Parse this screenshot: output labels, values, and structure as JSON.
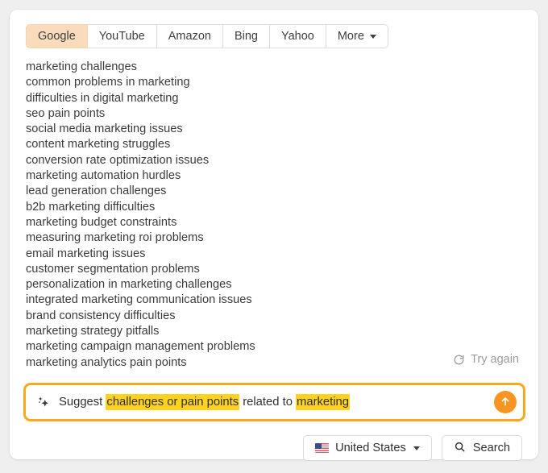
{
  "tabs": [
    {
      "label": "Google",
      "active": true,
      "caret": false,
      "name": "tab-google"
    },
    {
      "label": "YouTube",
      "active": false,
      "caret": false,
      "name": "tab-youtube"
    },
    {
      "label": "Amazon",
      "active": false,
      "caret": false,
      "name": "tab-amazon"
    },
    {
      "label": "Bing",
      "active": false,
      "caret": false,
      "name": "tab-bing"
    },
    {
      "label": "Yahoo",
      "active": false,
      "caret": false,
      "name": "tab-yahoo"
    },
    {
      "label": "More",
      "active": false,
      "caret": true,
      "name": "tab-more"
    }
  ],
  "suggestions": [
    "marketing challenges",
    "common problems in marketing",
    "difficulties in digital marketing",
    "seo pain points",
    "social media marketing issues",
    "content marketing struggles",
    "conversion rate optimization issues",
    "marketing automation hurdles",
    "lead generation challenges",
    "b2b marketing difficulties",
    "marketing budget constraints",
    "measuring marketing roi problems",
    "email marketing issues",
    "customer segmentation problems",
    "personalization in marketing challenges",
    "integrated marketing communication issues",
    "brand consistency difficulties",
    "marketing strategy pitfalls",
    "marketing campaign management problems",
    "marketing analytics pain points"
  ],
  "try_again": {
    "label": "Try again",
    "icon": "refresh-icon"
  },
  "prompt": {
    "icon": "sparkle-icon",
    "segments": [
      {
        "text": "Suggest ",
        "highlight": false
      },
      {
        "text": "challenges or pain points",
        "highlight": true
      },
      {
        "text": " related to ",
        "highlight": false
      },
      {
        "text": "marketing",
        "highlight": true
      }
    ],
    "send_icon": "arrow-up-icon"
  },
  "bottom_bar": {
    "country": {
      "label": "United States",
      "flag": "us-flag-icon",
      "caret": true
    },
    "search": {
      "label": "Search",
      "icon": "search-icon"
    }
  },
  "colors": {
    "page_background": "#efefef",
    "card_background": "#ffffff",
    "active_tab_background": "#fadcbc",
    "prompt_border": "#fba81f",
    "highlight": "#ffd21e",
    "send_button": "#f89522",
    "text": "#3b3b3b",
    "muted_text": "#9a9a9a"
  }
}
